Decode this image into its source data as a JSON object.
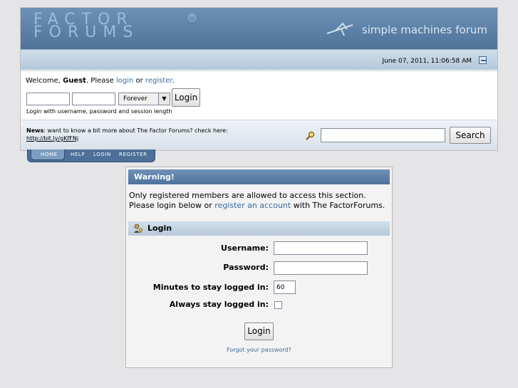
{
  "header": {
    "logo_line1": "FACTOR",
    "logo_line2": "FORUMS",
    "logo_mark": "®",
    "tagline": "simple machines forum",
    "datetime": "June 07, 2011, 11:06:58 AM"
  },
  "user": {
    "welcome_prefix": "Welcome, ",
    "guest": "Guest",
    "please": ". Please ",
    "login_link": "login",
    "or": " or ",
    "register_link": "register",
    "period": ".",
    "session_option": "Forever",
    "login_button": "Login",
    "help_text": "Login with username, password and session length"
  },
  "news": {
    "label": "News",
    "text": ": want to know a bit more about The Factor Forums? check here:",
    "link": "http://bit.ly/gKfFNj"
  },
  "search": {
    "button": "Search",
    "value": ""
  },
  "menu": {
    "items": [
      "HOME",
      "HELP",
      "LOGIN",
      "REGISTER"
    ]
  },
  "warning": {
    "title": "Warning!",
    "line1": "Only registered members are allowed to access this section.",
    "line2_prefix": "Please login below or ",
    "line2_link": "register an account",
    "line2_suffix": " with The FactorForums."
  },
  "login": {
    "title": "Login",
    "username_label": "Username:",
    "password_label": "Password:",
    "minutes_label": "Minutes to stay logged in:",
    "always_label": "Always stay logged in:",
    "minutes_value": "60",
    "button": "Login",
    "forgot": "Forgot your password?"
  }
}
